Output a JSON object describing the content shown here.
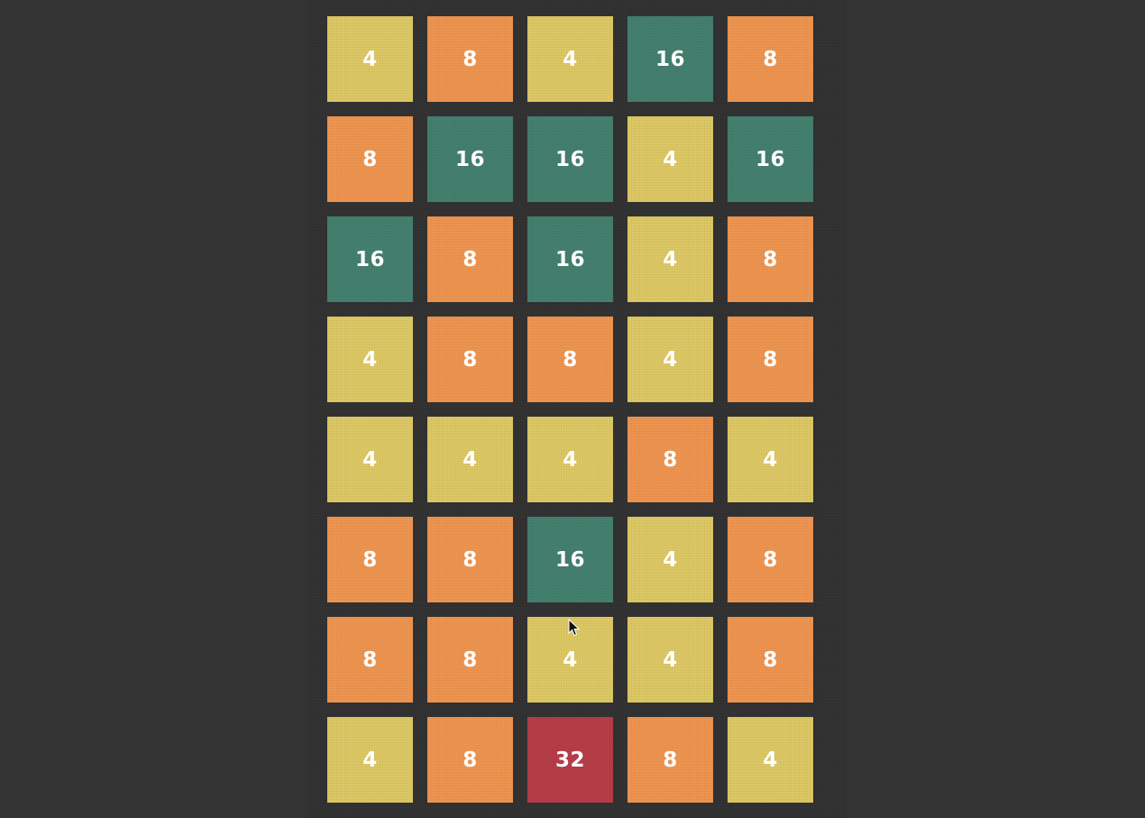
{
  "colors": {
    "background": "#333333",
    "tile_4": "#ddc865",
    "tile_8": "#ee9550",
    "tile_16": "#44806e",
    "tile_32": "#b63d48",
    "tile_text": "#ffffff"
  },
  "board": {
    "rows": [
      [
        "4",
        "8",
        "4",
        "16",
        "8"
      ],
      [
        "8",
        "16",
        "16",
        "4",
        "16"
      ],
      [
        "16",
        "8",
        "16",
        "4",
        "8"
      ],
      [
        "4",
        "8",
        "8",
        "4",
        "8"
      ],
      [
        "4",
        "4",
        "4",
        "8",
        "4"
      ],
      [
        "8",
        "8",
        "16",
        "4",
        "8"
      ],
      [
        "8",
        "8",
        "4",
        "4",
        "8"
      ],
      [
        "4",
        "8",
        "32",
        "8",
        "4"
      ]
    ]
  },
  "pointer": {
    "icon": "mouse-pointer-icon"
  }
}
